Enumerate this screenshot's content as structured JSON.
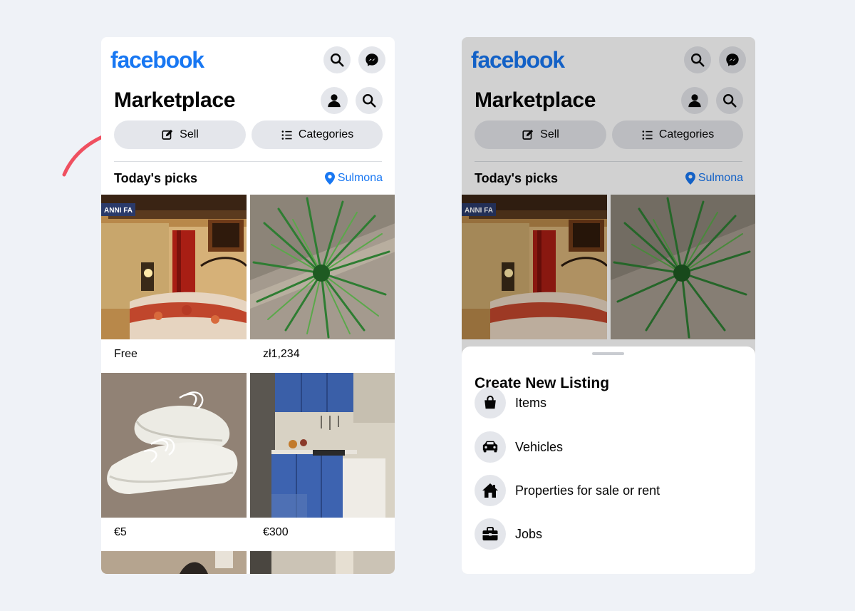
{
  "app": {
    "logo": "facebook",
    "page_title": "Marketplace",
    "sell_label": "Sell",
    "categories_label": "Categories",
    "section_title": "Today's picks",
    "location": "Sulmona"
  },
  "listings": [
    {
      "price": "Free",
      "photo": "bedroom",
      "tag": "ANNI FA"
    },
    {
      "price": "zł1,234",
      "photo": "plant"
    },
    {
      "price": "€5",
      "photo": "sneakers"
    },
    {
      "price": "€300",
      "photo": "kitchen"
    }
  ],
  "create_sheet": {
    "title": "Create New Listing",
    "options": [
      {
        "label": "Items",
        "icon": "shopping-bag-icon"
      },
      {
        "label": "Vehicles",
        "icon": "car-icon"
      },
      {
        "label": "Properties for sale or rent",
        "icon": "house-icon"
      },
      {
        "label": "Jobs",
        "icon": "briefcase-icon"
      }
    ]
  },
  "colors": {
    "brand": "#1877f2",
    "button_bg": "#e4e6eb",
    "annotation_arrow": "#ef5060",
    "background": "#eff2f7"
  }
}
